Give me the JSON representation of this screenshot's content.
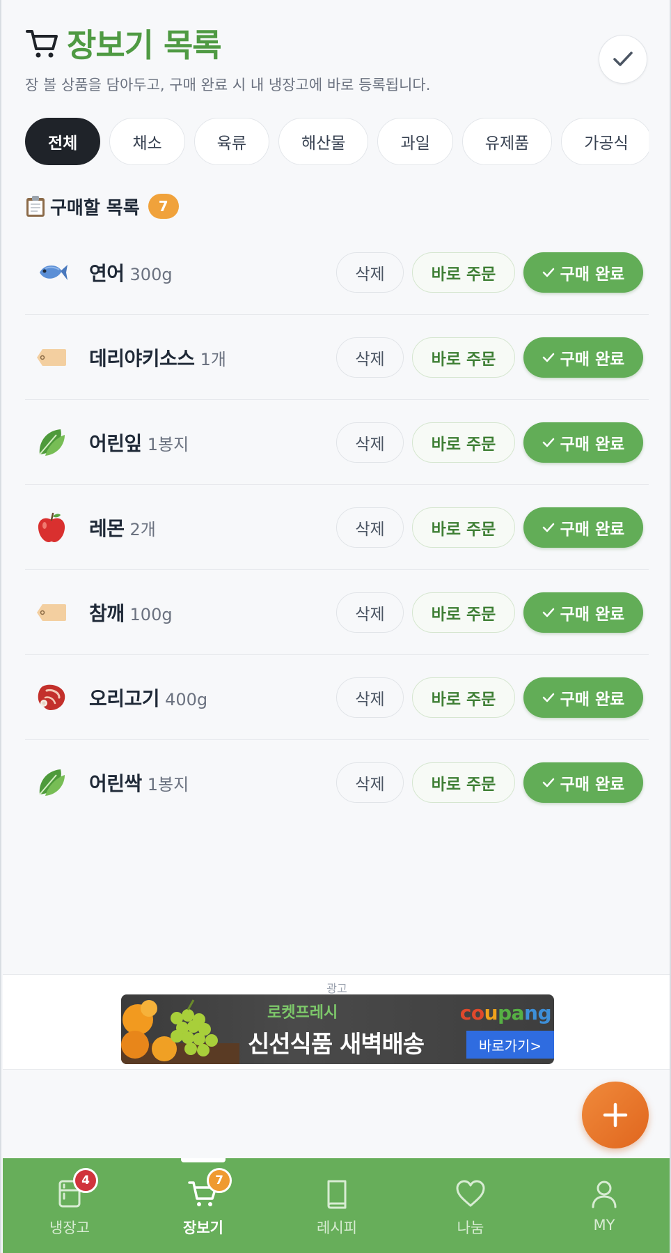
{
  "header": {
    "title": "장보기 목록",
    "subtitle": "장 볼 상품을 담아두고, 구매 완료 시 내 냉장고에 바로 등록됩니다."
  },
  "categories": [
    "전체",
    "채소",
    "육류",
    "해산물",
    "과일",
    "유제품",
    "가공식"
  ],
  "active_category": "전체",
  "section": {
    "title": "구매할 목록",
    "count": "7"
  },
  "buttons": {
    "delete": "삭제",
    "order": "바로 주문",
    "done": "구매 완료"
  },
  "items": [
    {
      "name": "연어",
      "qty": "300g",
      "icon": "fish-icon"
    },
    {
      "name": "데리야키소스",
      "qty": "1개",
      "icon": "tag-icon"
    },
    {
      "name": "어린잎",
      "qty": "1봉지",
      "icon": "leafy-greens-icon"
    },
    {
      "name": "레몬",
      "qty": "2개",
      "icon": "apple-icon"
    },
    {
      "name": "참깨",
      "qty": "100g",
      "icon": "tag-icon"
    },
    {
      "name": "오리고기",
      "qty": "400g",
      "icon": "meat-icon"
    },
    {
      "name": "어린싹",
      "qty": "1봉지",
      "icon": "leafy-greens-icon"
    }
  ],
  "ad": {
    "label": "광고",
    "tag": "로켓프레시",
    "headline": "신선식품 새벽배송",
    "brand": "coupang",
    "cta": "바로가기>"
  },
  "nav": [
    {
      "label": "냉장고",
      "badge": "4",
      "icon": "fridge-icon"
    },
    {
      "label": "장보기",
      "badge": "7",
      "icon": "cart-icon",
      "active": true
    },
    {
      "label": "레시피",
      "icon": "book-icon"
    },
    {
      "label": "나눔",
      "icon": "heart-icon"
    },
    {
      "label": "MY",
      "icon": "user-icon"
    }
  ],
  "colors": {
    "primary_green": "#62ad57",
    "title_green": "#4f9a43",
    "badge_orange": "#f0a23b",
    "fab_orange": "#e8772a",
    "badge_red": "#d0343c"
  }
}
